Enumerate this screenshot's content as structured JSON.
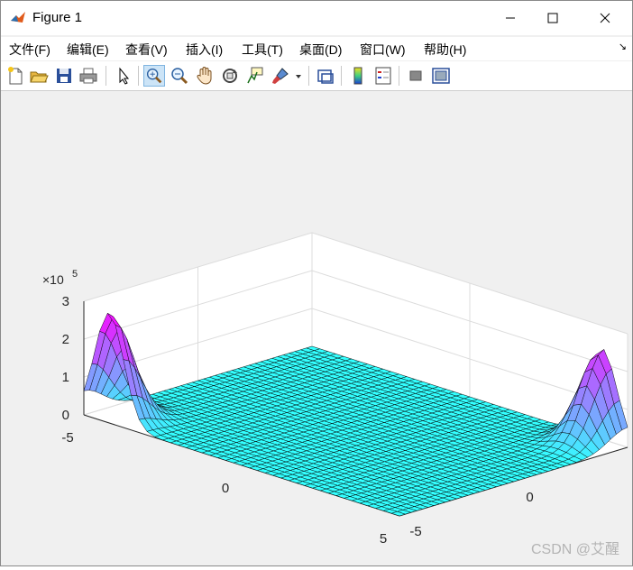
{
  "window": {
    "title": "Figure 1"
  },
  "menu": {
    "items": [
      "文件(F)",
      "编辑(E)",
      "查看(V)",
      "插入(I)",
      "工具(T)",
      "桌面(D)",
      "窗口(W)",
      "帮助(H)"
    ]
  },
  "toolbar": {
    "icons": [
      "new-figure-icon",
      "open-file-icon",
      "save-icon",
      "print-icon",
      "select-arrow-icon",
      "zoom-in-icon",
      "zoom-out-icon",
      "pan-hand-icon",
      "rotate-3d-icon",
      "data-cursor-icon",
      "brush-icon",
      "brush-dropdown-icon",
      "link-plot-icon",
      "colorbar-icon",
      "legend-icon",
      "hide-plot-tools-icon",
      "show-plot-tools-icon"
    ]
  },
  "chart_data": {
    "type": "surface",
    "x_ticks": [
      "-5",
      "0",
      "5"
    ],
    "y_ticks": [
      "-5",
      "0",
      "5"
    ],
    "z_ticks": [
      "0",
      "1",
      "2",
      "3"
    ],
    "z_exponent": "×10^5",
    "z_exponent_base": "×10",
    "z_exponent_power": "5",
    "xlim": [
      -5,
      5
    ],
    "ylim": [
      -5,
      5
    ],
    "zlim": [
      0,
      3
    ],
    "z_scale": 100000,
    "peaks": [
      {
        "x": -4.2,
        "y": -5,
        "z": 2.9
      },
      {
        "x": 4.2,
        "y": 5,
        "z": 2.4
      }
    ],
    "colors": {
      "low": "#33ffff",
      "high": "#ff00ff",
      "face": "#3ff0f5"
    },
    "grid": true
  },
  "watermark": "CSDN @艾醒"
}
